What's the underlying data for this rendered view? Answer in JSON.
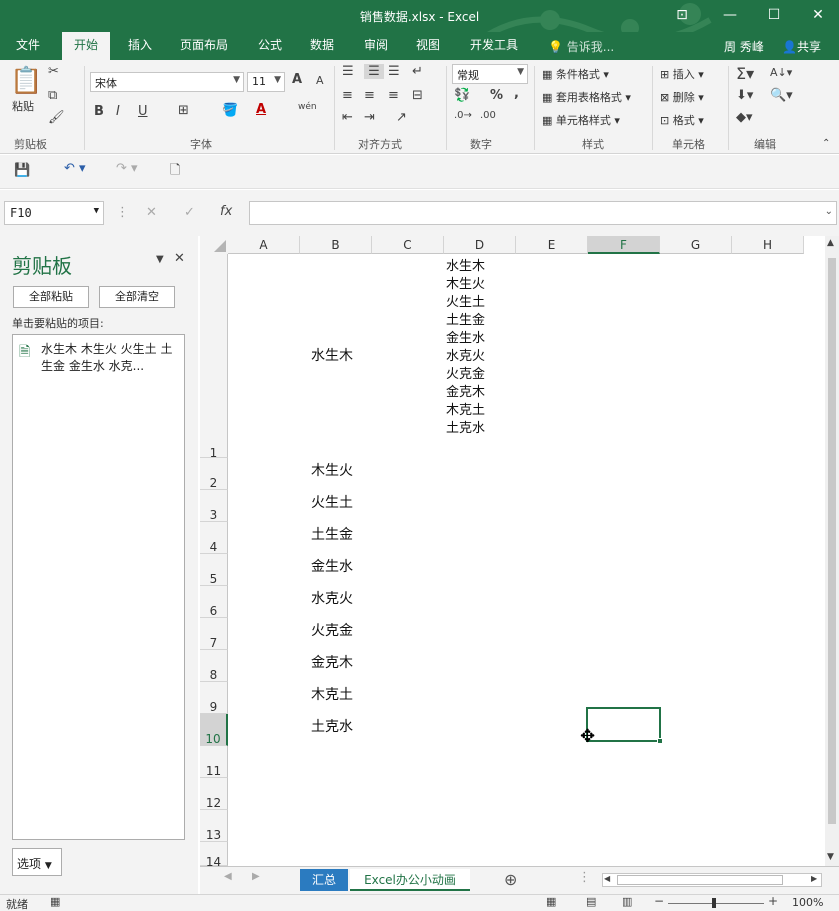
{
  "window": {
    "title": "销售数据.xlsx - Excel",
    "restore_icon": "ribbon-display-icon",
    "min_icon": "minimize-icon",
    "max_icon": "maximize-icon",
    "close_icon": "close-icon"
  },
  "tabs": [
    "文件",
    "开始",
    "插入",
    "页面布局",
    "公式",
    "数据",
    "审阅",
    "视图",
    "开发工具"
  ],
  "active_tab": "开始",
  "tell_me": "告诉我...",
  "user": "周 秀峰",
  "share": "共享",
  "ribbon": {
    "clipboard": {
      "paste": "粘贴",
      "label": "剪贴板"
    },
    "font": {
      "name": "宋体",
      "size": "11",
      "bold": "B",
      "italic": "I",
      "underline": "U",
      "grow": "A",
      "shrink": "A",
      "label": "字体",
      "phonetic": "wén"
    },
    "alignment": {
      "label": "对齐方式"
    },
    "number": {
      "format": "常规",
      "percent": "%",
      "comma": ",",
      "label": "数字"
    },
    "styles": {
      "conditional": "条件格式",
      "table": "套用表格格式",
      "cell": "单元格样式",
      "label": "样式"
    },
    "cells": {
      "insert": "插入",
      "delete": "删除",
      "format": "格式",
      "label": "单元格"
    },
    "editing": {
      "label": "编辑"
    }
  },
  "formula_bar": {
    "name_box": "F10",
    "fx": "fx",
    "formula": ""
  },
  "clipboard_pane": {
    "title": "剪贴板",
    "paste_all": "全部粘贴",
    "clear_all": "全部清空",
    "hint": "单击要粘贴的项目:",
    "item": "水生木 木生火 火生土 土生金 金生水 水克...",
    "options": "选项"
  },
  "grid": {
    "columns": [
      "A",
      "B",
      "C",
      "D",
      "E",
      "F",
      "G",
      "H"
    ],
    "selected_column": "F",
    "rows": [
      "1",
      "2",
      "3",
      "4",
      "5",
      "6",
      "7",
      "8",
      "9",
      "10",
      "11",
      "12",
      "13",
      "14"
    ],
    "selected_row": "10",
    "column_b": [
      "水生木",
      "木生火",
      "火生土",
      "土生金",
      "金生水",
      "水克火",
      "火克金",
      "金克木",
      "木克土",
      "土克水"
    ],
    "d1_lines": [
      "水生木",
      "木生火",
      "火生土",
      "土生金",
      "金生水",
      "水克火",
      "火克金",
      "金克木",
      "木克土",
      "土克水"
    ]
  },
  "sheet_tabs": [
    "汇总",
    "Excel办公小动画"
  ],
  "active_sheet": "Excel办公小动画",
  "status": {
    "ready": "就绪",
    "zoom": "100%"
  },
  "colors": {
    "accent": "#217346",
    "ribbon_bg": "#f3f3f3",
    "sheet_tab_blue": "#2b7bc0"
  }
}
